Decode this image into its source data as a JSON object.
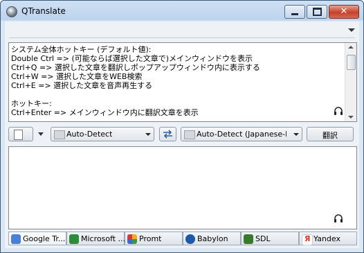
{
  "window": {
    "title": "QTranslate"
  },
  "source": {
    "lines": [
      "システム全体ホットキー (デフォルト値):",
      "Double Ctrl => (可能ならば選択した文章で)メインウィンドウを表示",
      "Ctrl+Q => 選択した文章を翻訳しポップアップウィンドウ内に表示する",
      "Ctrl+W => 選択した文章をWEB検索",
      "Ctrl+E => 選択した文章を音声再生する",
      "",
      "ホットキー:",
      "Ctrl+Enter => メインウィンドウ内に翻訳文章を表示"
    ]
  },
  "controls": {
    "source_language": "Auto-Detect",
    "target_language": "Auto-Detect (Japanese-Eng",
    "translate_label": "翻訳"
  },
  "tabs": [
    {
      "label": "Google Tr...",
      "icon": "google-translate-icon",
      "color": "#4a7fd6"
    },
    {
      "label": "Microsoft ...",
      "icon": "microsoft-translator-icon",
      "color": "#2e8b3a"
    },
    {
      "label": "Promt",
      "icon": "promt-icon",
      "color": "#e8b020"
    },
    {
      "label": "Babylon",
      "icon": "babylon-icon",
      "color": "#1c57a8"
    },
    {
      "label": "SDL",
      "icon": "sdl-icon",
      "color": "#3a7a2a"
    },
    {
      "label": "Yandex",
      "icon": "yandex-icon",
      "color": "#d23a2a"
    }
  ],
  "colors": {
    "close_button": "#c5412a",
    "titlebar": "#bcd3ee"
  }
}
